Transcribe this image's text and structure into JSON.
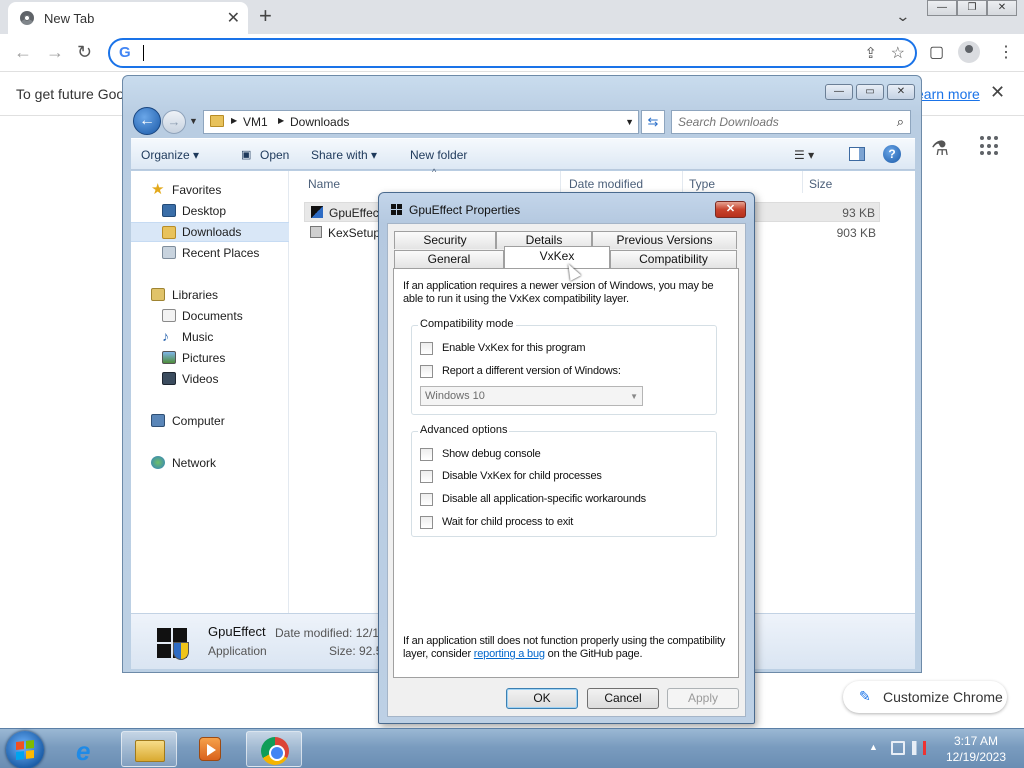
{
  "chrome": {
    "tab_title": "New Tab",
    "tab_close": "✕",
    "new_tab": "+",
    "tab_search": "⌄",
    "window_controls": [
      "—",
      "❐",
      "✕"
    ],
    "nav": {
      "back": "←",
      "forward": "→",
      "reload": "↻"
    },
    "omnibox": {
      "g": "G",
      "value": "",
      "share": "⇪",
      "bookmark": "☆"
    },
    "toolbar_icons": {
      "side_panel": "▢",
      "menu": "⋮"
    },
    "infobar": {
      "message": "To get future Goog",
      "learn_more": "earn more",
      "close": "✕"
    },
    "labs_icon": "⚗",
    "customize_label": "Customize Chrome",
    "customize_icon": "✎"
  },
  "explorer": {
    "window_controls": [
      "—",
      "▭",
      "✕"
    ],
    "breadcrumb": [
      "VM1",
      "Downloads"
    ],
    "breadcrumb_sep": "▶",
    "search_placeholder": "Search Downloads",
    "commands": {
      "organize": "Organize ▾",
      "open": "Open",
      "share_with": "Share with ▾",
      "new_folder": "New folder"
    },
    "nav_pane": {
      "favorites": "Favorites",
      "desktop": "Desktop",
      "downloads": "Downloads",
      "recent_places": "Recent Places",
      "libraries": "Libraries",
      "documents": "Documents",
      "music": "Music",
      "pictures": "Pictures",
      "videos": "Videos",
      "computer": "Computer",
      "network": "Network"
    },
    "columns": {
      "name": "Name",
      "date_modified": "Date modified",
      "type": "Type",
      "size": "Size"
    },
    "files": [
      {
        "name": "GpuEffect",
        "size": "93 KB"
      },
      {
        "name": "KexSetup_",
        "size": "903 KB"
      }
    ],
    "details": {
      "name": "GpuEffect",
      "type": "Application",
      "date_modified_label": "Date modified: 12/1",
      "size_label": "Size: 92.5"
    }
  },
  "dialog": {
    "title": "GpuEffect Properties",
    "close": "✕",
    "tabs": {
      "security": "Security",
      "details": "Details",
      "previous_versions": "Previous Versions",
      "general": "General",
      "vxkex": "VxKex",
      "compatibility": "Compatibility"
    },
    "intro": "If an application requires a newer version of Windows, you may be able to run it using the VxKex compatibility layer.",
    "compat_mode": {
      "label": "Compatibility mode",
      "enable": "Enable VxKex for this program",
      "report_version": "Report a different version of Windows:",
      "version_value": "Windows 10"
    },
    "advanced": {
      "label": "Advanced options",
      "debug_console": "Show debug console",
      "disable_child": "Disable VxKex for child processes",
      "disable_workarounds": "Disable all application-specific workarounds",
      "wait_child": "Wait for child process to exit"
    },
    "footer": {
      "before": "If an application still does not function properly using the compatibility layer, consider ",
      "link": "reporting a bug",
      "after": " on the GitHub page."
    },
    "buttons": {
      "ok": "OK",
      "cancel": "Cancel",
      "apply": "Apply"
    }
  },
  "taskbar": {
    "ie_glyph": "e",
    "time": "3:17 AM",
    "date": "12/19/2023",
    "tray_arrow": "▲"
  }
}
